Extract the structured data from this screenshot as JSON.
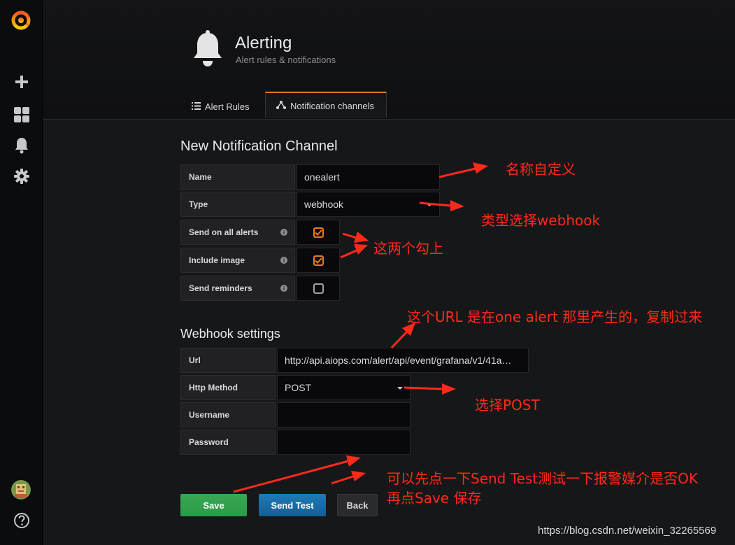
{
  "header": {
    "title": "Alerting",
    "subtitle": "Alert rules & notifications"
  },
  "tabs": [
    {
      "label": "Alert Rules",
      "active": false
    },
    {
      "label": "Notification channels",
      "active": true
    }
  ],
  "form": {
    "title": "New Notification Channel",
    "name_label": "Name",
    "name_value": "onealert",
    "type_label": "Type",
    "type_value": "webhook",
    "send_all_label": "Send on all alerts",
    "send_all_checked": true,
    "include_image_label": "Include image",
    "include_image_checked": true,
    "send_reminders_label": "Send reminders",
    "send_reminders_checked": false
  },
  "webhook": {
    "title": "Webhook settings",
    "url_label": "Url",
    "url_value": "http://api.aiops.com/alert/api/event/grafana/v1/41a…",
    "method_label": "Http Method",
    "method_value": "POST",
    "username_label": "Username",
    "username_value": "",
    "password_label": "Password",
    "password_value": ""
  },
  "buttons": {
    "save": "Save",
    "send_test": "Send Test",
    "back": "Back"
  },
  "annotations": {
    "name": "名称自定义",
    "type": "类型选择webhook",
    "checks": "这两个勾上",
    "url": "这个URL 是在one alert 那里产生的，复制过来",
    "method": "选择POST",
    "test_line1": "可以先点一下Send Test测试一下报警媒介是否OK",
    "test_line2": "再点Save 保存"
  },
  "watermark": "https://blog.csdn.net/weixin_32265569",
  "colors": {
    "accent": "#eb7b18",
    "save": "#299c46",
    "send_test": "#1f7bb6",
    "annotation": "#ff2a1a"
  }
}
